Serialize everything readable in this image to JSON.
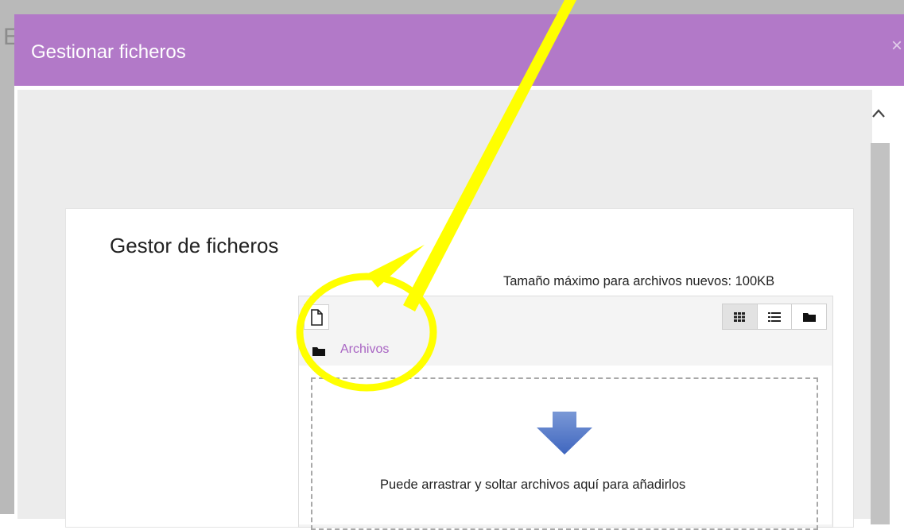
{
  "background": {
    "partial_letter": "E"
  },
  "modal": {
    "title": "Gestionar ficheros",
    "close_symbol": "×"
  },
  "card": {
    "title": "Gestor de ficheros"
  },
  "filemanager": {
    "max_size_text": "Tamaño máximo para archivos nuevos: 100KB",
    "breadcrumb_label": "Archivos",
    "drop_text": "Puede arrastrar y soltar archivos aquí para añadirlos",
    "icons": {
      "add": "file-icon",
      "views": [
        "grid-view-icon",
        "list-view-icon",
        "folder-view-icon"
      ],
      "drop": "arrow-down-icon"
    }
  },
  "colors": {
    "header": "#b279c8",
    "link": "#a864c3",
    "annotation": "#ffff00"
  }
}
